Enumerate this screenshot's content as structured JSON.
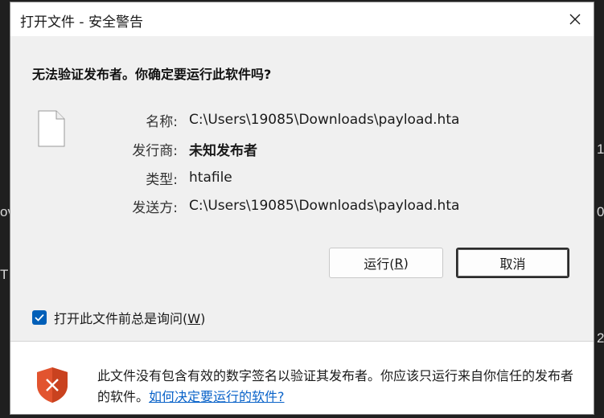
{
  "background": {
    "glyphs": [
      "1",
      "ov",
      "0",
      "T",
      "2"
    ]
  },
  "dialog": {
    "title": "打开文件 - 安全警告",
    "question": "无法验证发布者。你确定要运行此软件吗?",
    "fields": [
      {
        "label": "名称:",
        "value": "C:\\Users\\19085\\Downloads\\payload.hta",
        "bold": false
      },
      {
        "label": "发行商:",
        "value": "未知发布者",
        "bold": true
      },
      {
        "label": "类型:",
        "value": "htafile",
        "bold": false
      },
      {
        "label": "发送方:",
        "value": "C:\\Users\\19085\\Downloads\\payload.hta",
        "bold": false
      }
    ],
    "run_button": {
      "label": "运行(",
      "mnemonic": "R",
      "suffix": ")"
    },
    "cancel_button": {
      "label": "取消"
    },
    "checkbox": {
      "label": "打开此文件前总是询问(",
      "mnemonic": "W",
      "suffix": ")",
      "checked": true
    },
    "footer": {
      "text": "此文件没有包含有效的数字签名以验证其发布者。你应该只运行来自你信任的发布者的软件。",
      "link": "如何决定要运行的软件?"
    }
  },
  "colors": {
    "accent": "#005fb8",
    "link": "#0a63c9",
    "shield": "#e2542f"
  },
  "icons": [
    "file-icon",
    "close-icon",
    "check-icon",
    "shield-x-icon"
  ]
}
